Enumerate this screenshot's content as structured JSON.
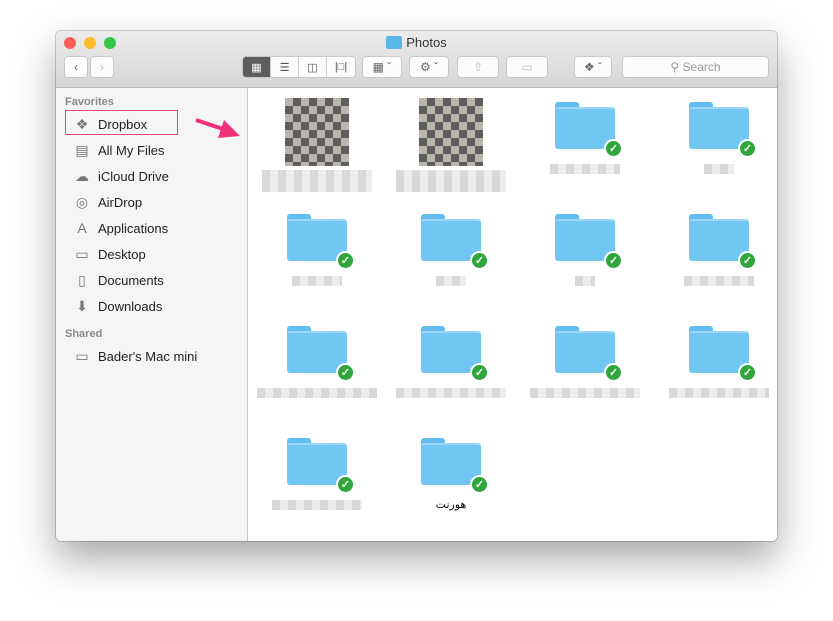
{
  "window": {
    "title": "Photos"
  },
  "toolbar": {
    "search_placeholder": "Search"
  },
  "sidebar": {
    "favorites_header": "Favorites",
    "favorites": [
      {
        "label": "Dropbox",
        "icon": "dropbox-icon"
      },
      {
        "label": "All My Files",
        "icon": "all-files-icon"
      },
      {
        "label": "iCloud Drive",
        "icon": "cloud-icon"
      },
      {
        "label": "AirDrop",
        "icon": "airdrop-icon"
      },
      {
        "label": "Applications",
        "icon": "applications-icon"
      },
      {
        "label": "Desktop",
        "icon": "desktop-icon"
      },
      {
        "label": "Documents",
        "icon": "documents-icon"
      },
      {
        "label": "Downloads",
        "icon": "downloads-icon"
      }
    ],
    "shared_header": "Shared",
    "shared": [
      {
        "label": "Bader's Mac mini",
        "icon": "computer-icon"
      }
    ]
  },
  "content": {
    "items": [
      {
        "type": "image",
        "synced": false
      },
      {
        "type": "image",
        "synced": false
      },
      {
        "type": "folder",
        "synced": true
      },
      {
        "type": "folder",
        "synced": true
      },
      {
        "type": "folder",
        "synced": true
      },
      {
        "type": "folder",
        "synced": true
      },
      {
        "type": "folder",
        "synced": true
      },
      {
        "type": "folder",
        "synced": true
      },
      {
        "type": "folder",
        "synced": true
      },
      {
        "type": "folder",
        "synced": true
      },
      {
        "type": "folder",
        "synced": true
      },
      {
        "type": "folder",
        "synced": true
      },
      {
        "type": "folder",
        "synced": true
      },
      {
        "type": "folder",
        "synced": true,
        "name": "هورنت"
      }
    ]
  },
  "colors": {
    "highlight": "#e04a7a",
    "arrow": "#f0327a",
    "sync": "#2fa53b",
    "folder": "#72c6f4"
  }
}
